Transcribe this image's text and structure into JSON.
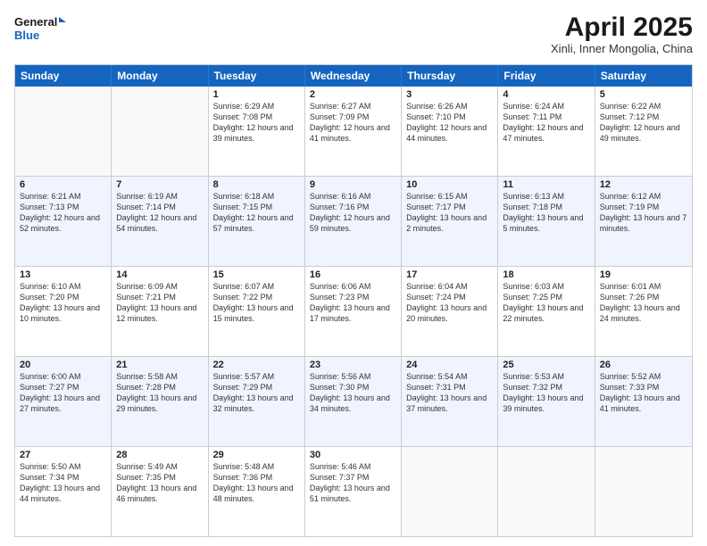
{
  "header": {
    "logo_line1": "General",
    "logo_line2": "Blue",
    "month": "April 2025",
    "location": "Xinli, Inner Mongolia, China"
  },
  "weekdays": [
    "Sunday",
    "Monday",
    "Tuesday",
    "Wednesday",
    "Thursday",
    "Friday",
    "Saturday"
  ],
  "rows": [
    [
      {
        "day": "",
        "sunrise": "",
        "sunset": "",
        "daylight": ""
      },
      {
        "day": "",
        "sunrise": "",
        "sunset": "",
        "daylight": ""
      },
      {
        "day": "1",
        "sunrise": "Sunrise: 6:29 AM",
        "sunset": "Sunset: 7:08 PM",
        "daylight": "Daylight: 12 hours and 39 minutes."
      },
      {
        "day": "2",
        "sunrise": "Sunrise: 6:27 AM",
        "sunset": "Sunset: 7:09 PM",
        "daylight": "Daylight: 12 hours and 41 minutes."
      },
      {
        "day": "3",
        "sunrise": "Sunrise: 6:26 AM",
        "sunset": "Sunset: 7:10 PM",
        "daylight": "Daylight: 12 hours and 44 minutes."
      },
      {
        "day": "4",
        "sunrise": "Sunrise: 6:24 AM",
        "sunset": "Sunset: 7:11 PM",
        "daylight": "Daylight: 12 hours and 47 minutes."
      },
      {
        "day": "5",
        "sunrise": "Sunrise: 6:22 AM",
        "sunset": "Sunset: 7:12 PM",
        "daylight": "Daylight: 12 hours and 49 minutes."
      }
    ],
    [
      {
        "day": "6",
        "sunrise": "Sunrise: 6:21 AM",
        "sunset": "Sunset: 7:13 PM",
        "daylight": "Daylight: 12 hours and 52 minutes."
      },
      {
        "day": "7",
        "sunrise": "Sunrise: 6:19 AM",
        "sunset": "Sunset: 7:14 PM",
        "daylight": "Daylight: 12 hours and 54 minutes."
      },
      {
        "day": "8",
        "sunrise": "Sunrise: 6:18 AM",
        "sunset": "Sunset: 7:15 PM",
        "daylight": "Daylight: 12 hours and 57 minutes."
      },
      {
        "day": "9",
        "sunrise": "Sunrise: 6:16 AM",
        "sunset": "Sunset: 7:16 PM",
        "daylight": "Daylight: 12 hours and 59 minutes."
      },
      {
        "day": "10",
        "sunrise": "Sunrise: 6:15 AM",
        "sunset": "Sunset: 7:17 PM",
        "daylight": "Daylight: 13 hours and 2 minutes."
      },
      {
        "day": "11",
        "sunrise": "Sunrise: 6:13 AM",
        "sunset": "Sunset: 7:18 PM",
        "daylight": "Daylight: 13 hours and 5 minutes."
      },
      {
        "day": "12",
        "sunrise": "Sunrise: 6:12 AM",
        "sunset": "Sunset: 7:19 PM",
        "daylight": "Daylight: 13 hours and 7 minutes."
      }
    ],
    [
      {
        "day": "13",
        "sunrise": "Sunrise: 6:10 AM",
        "sunset": "Sunset: 7:20 PM",
        "daylight": "Daylight: 13 hours and 10 minutes."
      },
      {
        "day": "14",
        "sunrise": "Sunrise: 6:09 AM",
        "sunset": "Sunset: 7:21 PM",
        "daylight": "Daylight: 13 hours and 12 minutes."
      },
      {
        "day": "15",
        "sunrise": "Sunrise: 6:07 AM",
        "sunset": "Sunset: 7:22 PM",
        "daylight": "Daylight: 13 hours and 15 minutes."
      },
      {
        "day": "16",
        "sunrise": "Sunrise: 6:06 AM",
        "sunset": "Sunset: 7:23 PM",
        "daylight": "Daylight: 13 hours and 17 minutes."
      },
      {
        "day": "17",
        "sunrise": "Sunrise: 6:04 AM",
        "sunset": "Sunset: 7:24 PM",
        "daylight": "Daylight: 13 hours and 20 minutes."
      },
      {
        "day": "18",
        "sunrise": "Sunrise: 6:03 AM",
        "sunset": "Sunset: 7:25 PM",
        "daylight": "Daylight: 13 hours and 22 minutes."
      },
      {
        "day": "19",
        "sunrise": "Sunrise: 6:01 AM",
        "sunset": "Sunset: 7:26 PM",
        "daylight": "Daylight: 13 hours and 24 minutes."
      }
    ],
    [
      {
        "day": "20",
        "sunrise": "Sunrise: 6:00 AM",
        "sunset": "Sunset: 7:27 PM",
        "daylight": "Daylight: 13 hours and 27 minutes."
      },
      {
        "day": "21",
        "sunrise": "Sunrise: 5:58 AM",
        "sunset": "Sunset: 7:28 PM",
        "daylight": "Daylight: 13 hours and 29 minutes."
      },
      {
        "day": "22",
        "sunrise": "Sunrise: 5:57 AM",
        "sunset": "Sunset: 7:29 PM",
        "daylight": "Daylight: 13 hours and 32 minutes."
      },
      {
        "day": "23",
        "sunrise": "Sunrise: 5:56 AM",
        "sunset": "Sunset: 7:30 PM",
        "daylight": "Daylight: 13 hours and 34 minutes."
      },
      {
        "day": "24",
        "sunrise": "Sunrise: 5:54 AM",
        "sunset": "Sunset: 7:31 PM",
        "daylight": "Daylight: 13 hours and 37 minutes."
      },
      {
        "day": "25",
        "sunrise": "Sunrise: 5:53 AM",
        "sunset": "Sunset: 7:32 PM",
        "daylight": "Daylight: 13 hours and 39 minutes."
      },
      {
        "day": "26",
        "sunrise": "Sunrise: 5:52 AM",
        "sunset": "Sunset: 7:33 PM",
        "daylight": "Daylight: 13 hours and 41 minutes."
      }
    ],
    [
      {
        "day": "27",
        "sunrise": "Sunrise: 5:50 AM",
        "sunset": "Sunset: 7:34 PM",
        "daylight": "Daylight: 13 hours and 44 minutes."
      },
      {
        "day": "28",
        "sunrise": "Sunrise: 5:49 AM",
        "sunset": "Sunset: 7:35 PM",
        "daylight": "Daylight: 13 hours and 46 minutes."
      },
      {
        "day": "29",
        "sunrise": "Sunrise: 5:48 AM",
        "sunset": "Sunset: 7:36 PM",
        "daylight": "Daylight: 13 hours and 48 minutes."
      },
      {
        "day": "30",
        "sunrise": "Sunrise: 5:46 AM",
        "sunset": "Sunset: 7:37 PM",
        "daylight": "Daylight: 13 hours and 51 minutes."
      },
      {
        "day": "",
        "sunrise": "",
        "sunset": "",
        "daylight": ""
      },
      {
        "day": "",
        "sunrise": "",
        "sunset": "",
        "daylight": ""
      },
      {
        "day": "",
        "sunrise": "",
        "sunset": "",
        "daylight": ""
      }
    ]
  ]
}
